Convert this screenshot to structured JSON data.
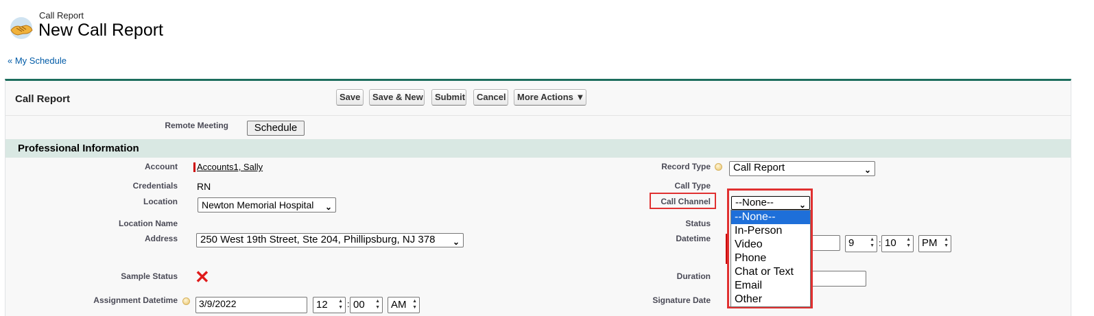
{
  "header": {
    "object_label": "Call Report",
    "page_title": "New Call Report",
    "back_prefix": "« ",
    "back_link": "My Schedule"
  },
  "panel": {
    "title": "Call Report",
    "buttons": [
      "Save",
      "Save & New",
      "Submit",
      "Cancel",
      "More Actions ▼"
    ]
  },
  "remote_meeting": {
    "label": "Remote Meeting",
    "button": "Schedule"
  },
  "section": {
    "title": "Professional Information"
  },
  "left_fields": {
    "account_label": "Account",
    "account_value": "Accounts1, Sally",
    "credentials_label": "Credentials",
    "credentials_value": "RN",
    "location_label": "Location",
    "location_value": "Newton Memorial Hospital",
    "location_name_label": "Location Name",
    "address_label": "Address",
    "address_value": "250 West 19th Street, Ste 204, Phillipsburg, NJ 378",
    "sample_status_label": "Sample Status",
    "assignment_label": "Assignment Datetime",
    "assignment_date": "3/9/2022",
    "assignment_hour": "12",
    "assignment_minute": "00",
    "assignment_ampm": "AM"
  },
  "right_fields": {
    "record_type_label": "Record Type",
    "record_type_value": "Call Report",
    "call_type_label": "Call Type",
    "call_channel_label": "Call Channel",
    "call_channel_value": "--None--",
    "status_label": "Status",
    "datetime_label": "Datetime",
    "datetime_hour": "9",
    "datetime_minute": "10",
    "datetime_ampm": "PM",
    "datetime_link_fragment": "]",
    "duration_label": "Duration",
    "signature_label": "Signature Date"
  },
  "call_channel_options": [
    "--None--",
    "In-Person",
    "Video",
    "Phone",
    "Chat or Text",
    "Email",
    "Other"
  ],
  "colors": {
    "accent_border": "#1c6d5d",
    "section_bar": "#d9e8e3",
    "highlight": "#e03030",
    "selected_option": "#1e6fd9",
    "required": "#cc0000"
  }
}
